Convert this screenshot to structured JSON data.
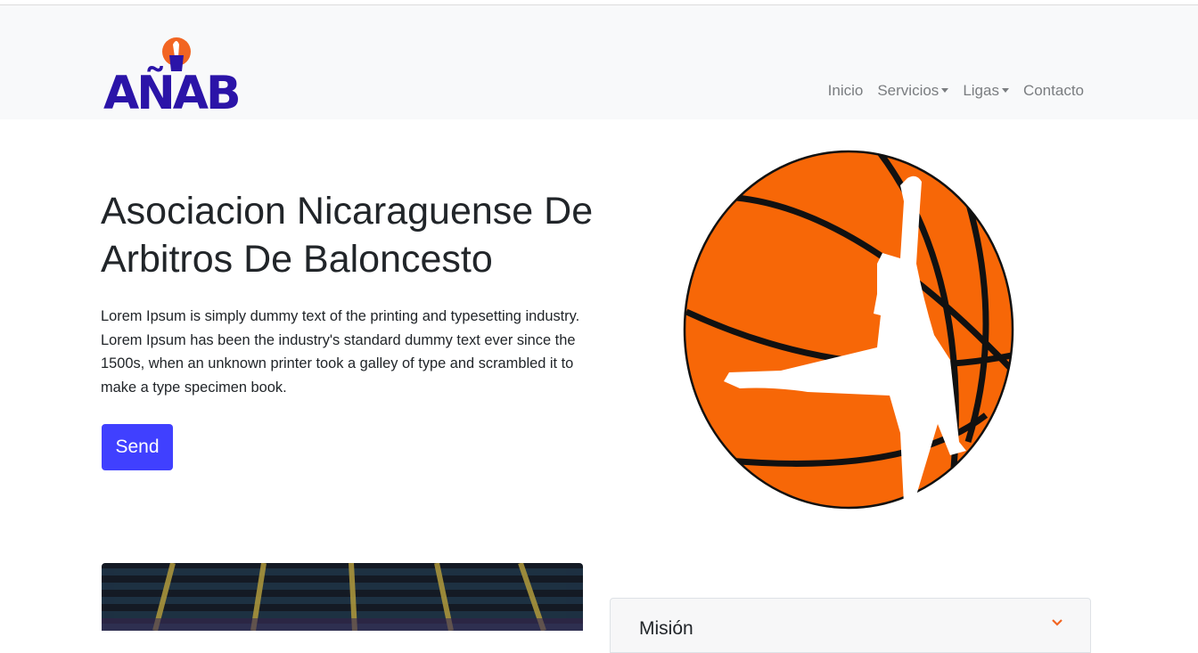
{
  "brand": {
    "logo_text": "AÑAB"
  },
  "nav": {
    "items": [
      {
        "label": "Inicio"
      },
      {
        "label": "Servicios"
      },
      {
        "label": "Ligas"
      },
      {
        "label": "Contacto"
      }
    ]
  },
  "hero": {
    "title": "Asociacion Nicaraguense De Arbitros De Baloncesto",
    "text": "Lorem Ipsum is simply dummy text of the printing and typesetting industry. Lorem Ipsum has been the industry's standard dummy text ever since the 1500s, when an unknown printer took a galley of type and scrambled it to make a type specimen book.",
    "button_label": "Send"
  },
  "accordion": {
    "first_item_title": "Misión"
  },
  "colors": {
    "brand_purple": "#2b14a8",
    "brand_orange": "#f26522",
    "button_blue": "#4040ff",
    "ball_orange": "#f76707"
  },
  "icons": {
    "caret": "caret-down-icon",
    "chevron": "chevron-down-icon"
  }
}
